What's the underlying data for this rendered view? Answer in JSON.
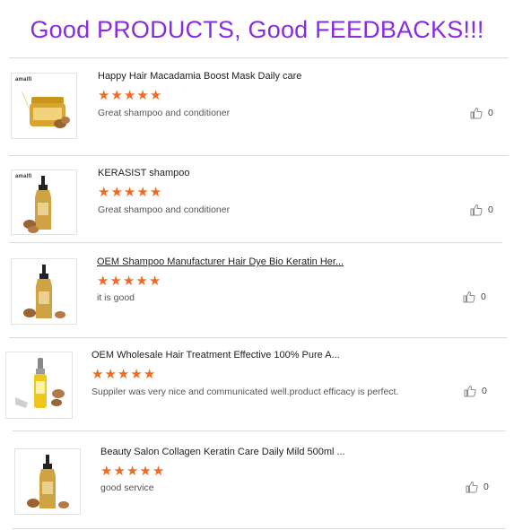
{
  "page": {
    "title": "Good PRODUCTS, Good FEEDBACKS!!!",
    "title_color": "#8a2be2",
    "star_color": "#f06a22"
  },
  "reviews": [
    {
      "brand": "amalfi",
      "product": "Happy Hair Macadamia Boost Mask Daily care",
      "rating": 5,
      "comment": "Great shampoo and conditioner",
      "likes": "0",
      "icon": "jar-product-image",
      "link": false
    },
    {
      "brand": "amalfi",
      "product": "KERASIST shampoo",
      "rating": 5,
      "comment": "Great shampoo and conditioner",
      "likes": "0",
      "icon": "bottle-product-image",
      "link": false
    },
    {
      "brand": "",
      "product": "OEM Shampoo Manufacturer Hair Dye Bio Keratin Her...",
      "rating": 5,
      "comment": "it is good",
      "likes": "0",
      "icon": "bottle-product-image",
      "link": true
    },
    {
      "brand": "",
      "product": "OEM Wholesale Hair Treatment Effective 100% Pure A...",
      "rating": 5,
      "comment": "Suppiler was very nice and communicated well.product efficacy is perfect.",
      "likes": "0",
      "icon": "oil-dropper-product-image",
      "link": false
    },
    {
      "brand": "",
      "product": "Beauty Salon Collagen Keratin Care Daily Mild 500ml ...",
      "rating": 5,
      "comment": "good service",
      "likes": "0",
      "icon": "bottle-product-image",
      "link": false
    }
  ]
}
